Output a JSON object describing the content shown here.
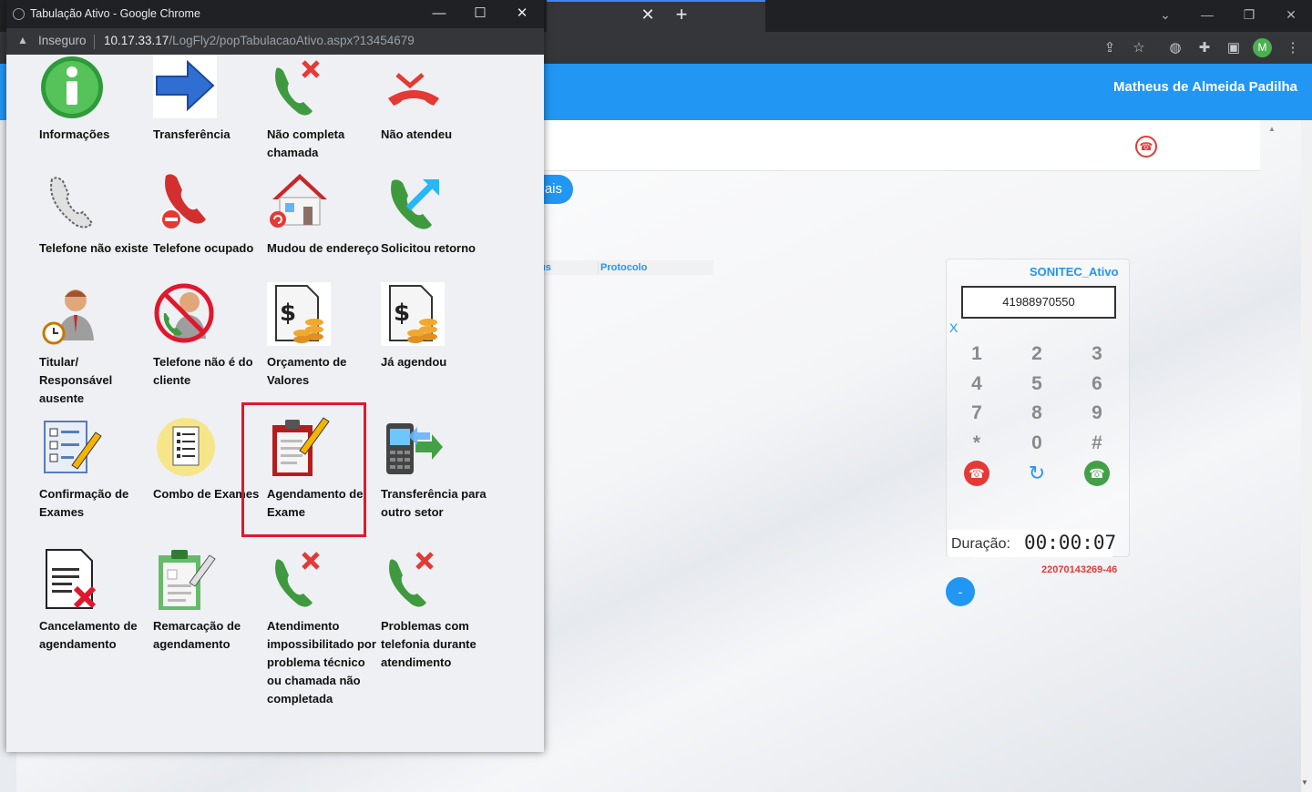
{
  "background_window": {
    "new_tab_label": "+",
    "close_tab_label": "✕",
    "user_name": "Matheus de Almeida Padilha",
    "avatar_letter": "M",
    "pill_button_label": "ais",
    "table_headers": [
      "us",
      "Protocolo"
    ],
    "dialer": {
      "title": "SONITEC_Ativo",
      "number": "41988970550",
      "clear_label": "X",
      "keys": [
        "1",
        "2",
        "3",
        "4",
        "5",
        "6",
        "7",
        "8",
        "9",
        "*",
        "0",
        "#"
      ],
      "duration_label": "Duração:",
      "duration_value": "00:00:07",
      "call_id": "22070143269-46",
      "minus_label": "-"
    }
  },
  "popup": {
    "title": "Tabulação Ativo - Google Chrome",
    "insecure_label": "Inseguro",
    "url_host": "10.17.33.17",
    "url_path": "/LogFly2/popTabulacaoAtivo.aspx?13454679",
    "tiles": [
      {
        "label": "Informações",
        "icon": "info-icon"
      },
      {
        "label": "Transferência",
        "icon": "arrow-right-icon"
      },
      {
        "label": "Não completa chamada",
        "icon": "phone-failed-icon"
      },
      {
        "label": "Não atendeu",
        "icon": "phone-missed-icon"
      },
      {
        "label": "Telefone não existe",
        "icon": "phone-outline-icon"
      },
      {
        "label": "Telefone ocupado",
        "icon": "phone-busy-icon"
      },
      {
        "label": "Mudou de endereço",
        "icon": "house-icon"
      },
      {
        "label": "Solicitou retorno",
        "icon": "phone-callback-icon"
      },
      {
        "label": "Titular/ Responsável ausente",
        "icon": "person-clock-icon"
      },
      {
        "label": "Telefone não é do cliente",
        "icon": "person-forbidden-icon"
      },
      {
        "label": "Orçamento de Valores",
        "icon": "document-money-icon"
      },
      {
        "label": "Já agendou",
        "icon": "document-money-icon"
      },
      {
        "label": "Confirmação de Exames",
        "icon": "checklist-pencil-icon"
      },
      {
        "label": "Combo de Exames",
        "icon": "checklist-circle-icon"
      },
      {
        "label": "Agendamento de Exame",
        "icon": "clipboard-pencil-icon"
      },
      {
        "label": "Transferência para outro setor",
        "icon": "cellphone-transfer-icon"
      },
      {
        "label": "Cancelamento de agendamento",
        "icon": "document-cancel-icon"
      },
      {
        "label": "Remarcação de agendamento",
        "icon": "clipboard-edit-icon"
      },
      {
        "label": "Atendimento impossibilitado por problema técnico ou chamada não completada",
        "icon": "phone-failed-icon"
      },
      {
        "label": "Problemas com telefonia durante atendimento",
        "icon": "phone-failed-icon"
      }
    ]
  },
  "colors": {
    "accent": "#2196f3",
    "highlight": "#e0182d",
    "alert": "#e53935",
    "call_green": "#43a047"
  }
}
